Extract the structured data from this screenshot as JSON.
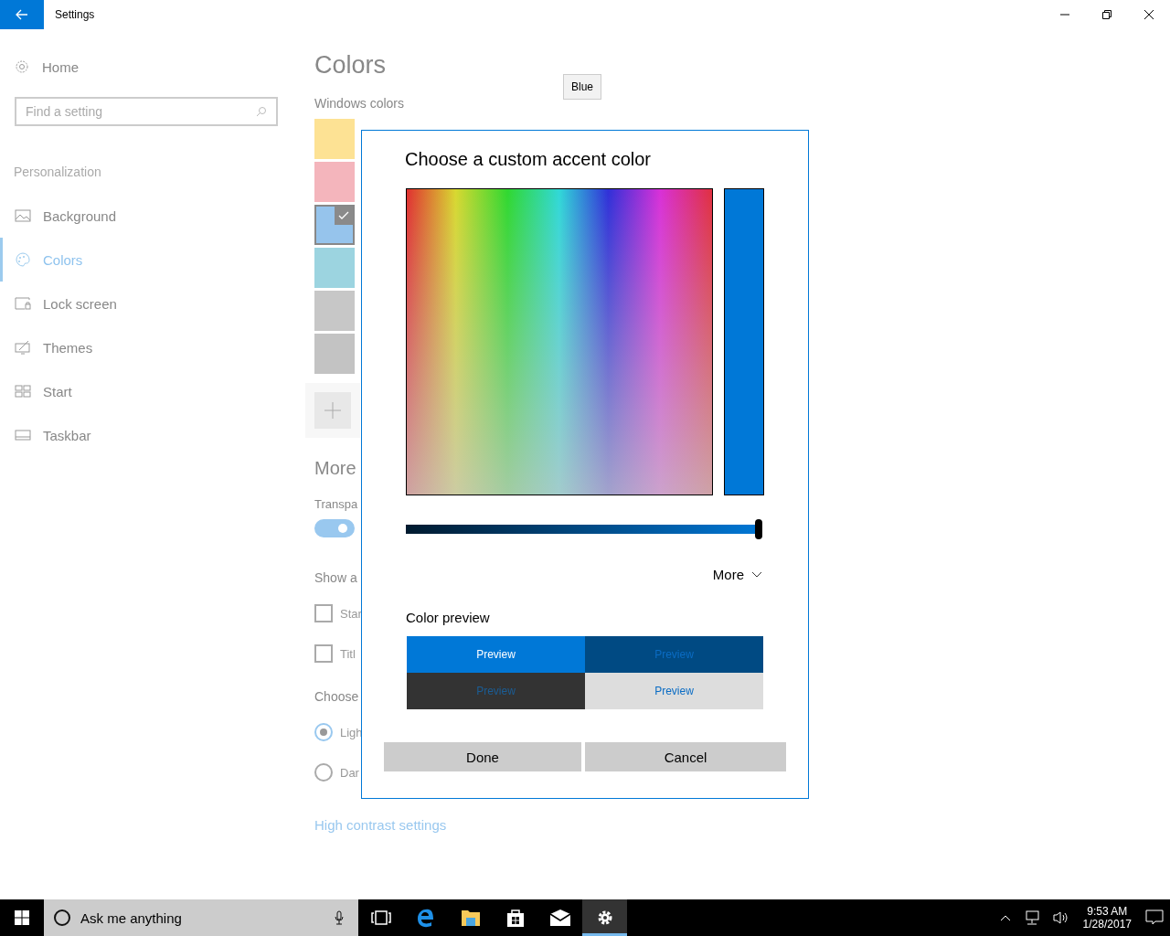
{
  "window": {
    "title": "Settings"
  },
  "sidebar": {
    "home": "Home",
    "search": {
      "placeholder": "Find a setting"
    },
    "section": "Personalization",
    "items": [
      {
        "label": "Background",
        "selected": false
      },
      {
        "label": "Colors",
        "selected": true
      },
      {
        "label": "Lock screen",
        "selected": false
      },
      {
        "label": "Themes",
        "selected": false
      },
      {
        "label": "Start",
        "selected": false
      },
      {
        "label": "Taskbar",
        "selected": false
      }
    ]
  },
  "content": {
    "title": "Colors",
    "windows_colors_label": "Windows colors",
    "swatches": [
      {
        "color": "#fde294",
        "selected": false
      },
      {
        "color": "#f4b5bc",
        "selected": false
      },
      {
        "color": "#96c4ec",
        "selected": true
      },
      {
        "color": "#9cd4e0",
        "selected": false
      },
      {
        "color": "#c7c7c7",
        "selected": false
      },
      {
        "color": "#c3c3c3",
        "selected": false
      }
    ],
    "more_heading": "More",
    "transparency_label": "Transpa",
    "transparency_toggle": {
      "on": true
    },
    "show_accent_label": "Show a",
    "checkboxes": [
      {
        "label": "Star",
        "checked": false
      },
      {
        "label": "Titl",
        "checked": false
      }
    ],
    "mode_label": "Choose",
    "radios": [
      {
        "label": "Ligh",
        "selected": true
      },
      {
        "label": "Dar",
        "selected": false
      }
    ],
    "high_contrast_link": "High contrast settings"
  },
  "tooltip": "Blue",
  "dialog": {
    "title": "Choose a custom accent color",
    "brightness_slider": {
      "level": 1.0
    },
    "more": "More",
    "preview_label": "Color preview",
    "previews": [
      "Preview",
      "Preview",
      "Preview",
      "Preview"
    ],
    "buttons": [
      "Done",
      "Cancel"
    ]
  },
  "taskbar": {
    "search_placeholder": "Ask me anything",
    "apps": [
      {
        "active": false
      },
      {
        "active": false
      },
      {
        "active": false
      },
      {
        "active": false
      },
      {
        "active": false
      },
      {
        "active": true
      }
    ],
    "time": "9:53 AM",
    "date": "1/28/2017"
  }
}
